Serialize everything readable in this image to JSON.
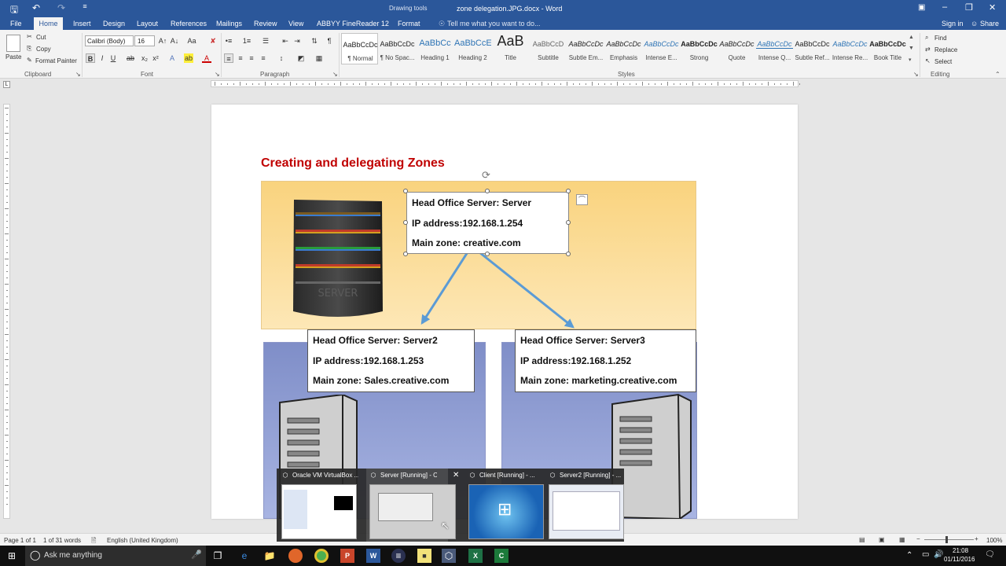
{
  "window": {
    "title": "zone delegation.JPG.docx - Word",
    "context_tab": "Drawing tools"
  },
  "quick_access": [
    "save-icon",
    "undo-icon",
    "redo-icon",
    "customize-icon"
  ],
  "menu": {
    "tabs": [
      "File",
      "Home",
      "Insert",
      "Design",
      "Layout",
      "References",
      "Mailings",
      "Review",
      "View",
      "ABBYY FineReader 12",
      "Format"
    ],
    "tell_me": "Tell me what you want to do...",
    "sign_in": "Sign in",
    "share": "Share"
  },
  "ribbon": {
    "clipboard": {
      "paste": "Paste",
      "cut": "Cut",
      "copy": "Copy",
      "format_painter": "Format Painter",
      "group": "Clipboard"
    },
    "font": {
      "name": "Calibri (Body)",
      "size": "16",
      "group": "Font"
    },
    "paragraph": {
      "group": "Paragraph"
    },
    "styles": {
      "group": "Styles",
      "items": [
        {
          "preview": "AaBbCcDc",
          "name": "¶ Normal"
        },
        {
          "preview": "AaBbCcDc",
          "name": "¶ No Spac..."
        },
        {
          "preview": "AaBbCc",
          "name": "Heading 1"
        },
        {
          "preview": "AaBbCcE",
          "name": "Heading 2"
        },
        {
          "preview": "AaB",
          "name": "Title"
        },
        {
          "preview": "AaBbCcD",
          "name": "Subtitle"
        },
        {
          "preview": "AaBbCcDc",
          "name": "Subtle Em..."
        },
        {
          "preview": "AaBbCcDc",
          "name": "Emphasis"
        },
        {
          "preview": "AaBbCcDc",
          "name": "Intense E..."
        },
        {
          "preview": "AaBbCcDc",
          "name": "Strong"
        },
        {
          "preview": "AaBbCcDc",
          "name": "Quote"
        },
        {
          "preview": "AaBbCcDc",
          "name": "Intense Q..."
        },
        {
          "preview": "AaBbCcDc",
          "name": "Subtle Ref..."
        },
        {
          "preview": "AaBbCcDc",
          "name": "Intense Re..."
        },
        {
          "preview": "AaBbCcDc",
          "name": "Book Title"
        }
      ]
    },
    "editing": {
      "find": "Find",
      "replace": "Replace",
      "select": "Select",
      "group": "Editing"
    }
  },
  "document": {
    "heading": "Creating and delegating Zones",
    "main_server": {
      "line1": "Head Office Server: Server",
      "line2": "IP address:192.168.1.254",
      "line3": "Main zone: creative.com"
    },
    "server2": {
      "line1": "Head Office Server: Server2",
      "line2": "IP address:192.168.1.253",
      "line3": "Main zone: Sales.creative.com"
    },
    "server3": {
      "line1": "Head Office Server: Server3",
      "line2": "IP address:192.168.1.252",
      "line3": "Main zone: marketing.creative.com"
    },
    "server_label": "SERVER",
    "colors": {
      "heading": "#c00000",
      "top_panel": "#fbd88a",
      "bottom_panel": "#9aa6d8",
      "arrow": "#5b9bd5"
    }
  },
  "status": {
    "page": "Page 1 of 1",
    "words": "1 of 31 words",
    "language": "English (United Kingdom)",
    "zoom": "100%"
  },
  "taskbar": {
    "search": "Ask me anything",
    "time": "21:08",
    "date": "01/11/2016",
    "apps": [
      "task-view-icon",
      "edge-icon",
      "file-explorer-icon",
      "firefox-icon",
      "chrome-icon",
      "powerpoint-icon",
      "word-icon",
      "virtualbox-manager-icon",
      "sticky-notes-icon",
      "virtualbox-icon",
      "excel-icon",
      "camtasia-icon"
    ]
  },
  "thumbnails": [
    {
      "title": "Oracle VM VirtualBox ..."
    },
    {
      "title": "Server [Running] - Or..."
    },
    {
      "title": "Client [Running] - ..."
    },
    {
      "title": "Server2 [Running] - ..."
    }
  ]
}
